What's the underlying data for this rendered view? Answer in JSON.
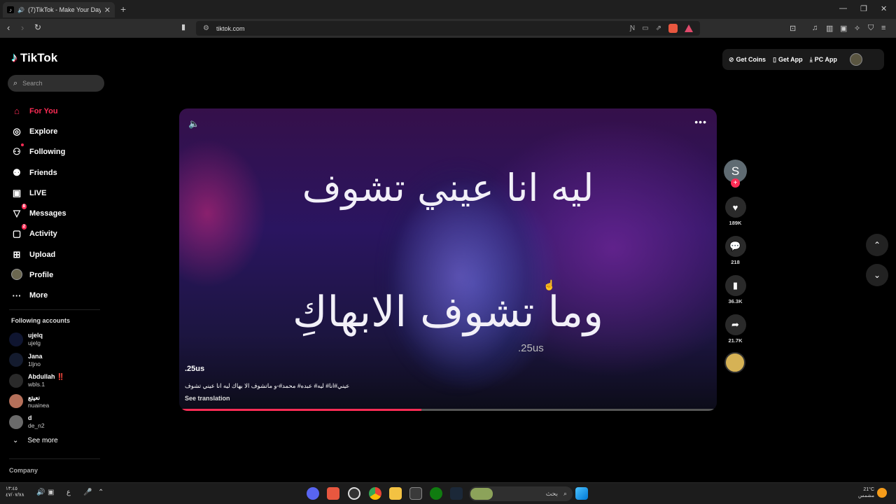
{
  "browser": {
    "tab_title": "(7)TikTok - Make Your Day",
    "url": "tiktok.com"
  },
  "sidebar": {
    "brand": "TikTok",
    "search_placeholder": "Search",
    "nav": [
      {
        "label": "For You",
        "icon": "home-icon",
        "active": true
      },
      {
        "label": "Explore",
        "icon": "compass-icon"
      },
      {
        "label": "Following",
        "icon": "following-icon"
      },
      {
        "label": "Friends",
        "icon": "friends-icon"
      },
      {
        "label": "LIVE",
        "icon": "live-icon"
      },
      {
        "label": "Messages",
        "icon": "messages-icon",
        "badge": "8"
      },
      {
        "label": "Activity",
        "icon": "activity-icon",
        "badge": "2"
      },
      {
        "label": "Upload",
        "icon": "upload-icon"
      },
      {
        "label": "Profile",
        "icon": "profile-icon"
      },
      {
        "label": "More",
        "icon": "more-icon"
      }
    ],
    "following_title": "Following accounts",
    "accounts": [
      {
        "name": "ujelq",
        "user": "ujelg"
      },
      {
        "name": "Jana",
        "user": "1ljno"
      },
      {
        "name": "Abdullah ‼️",
        "user": "wbls.1"
      },
      {
        "name": "نعيتع",
        "user": "nuainea"
      },
      {
        "name": "d",
        "user": "de_n2"
      }
    ],
    "see_more": "See more",
    "company": "Company"
  },
  "top_actions": {
    "get_coins": "Get Coins",
    "get_app": "Get App",
    "pc_app": "PC App"
  },
  "video": {
    "lyric_line1": "ليه انا عيني تشوف",
    "lyric_line2": "وما تشوف الابهاكِ",
    "overlay_handle": ".25us",
    "author": ".25us",
    "caption": "عيني#انا# ليه# عبده# محمد#-و ماتشوف الا بهاك ليه انا عيني تشوف",
    "see_translation": "See translation",
    "progress": 0.45
  },
  "actions": {
    "creator_initial": "S",
    "likes": "189K",
    "comments": "218",
    "saves": "36.3K",
    "shares": "21.7K"
  },
  "taskbar": {
    "time": "١٣:٤٥",
    "date": "٤٧/٠٧/٧٨",
    "lang": "ع",
    "search_text": "بحث",
    "temperature": "21°C",
    "weather": "مشمس"
  }
}
